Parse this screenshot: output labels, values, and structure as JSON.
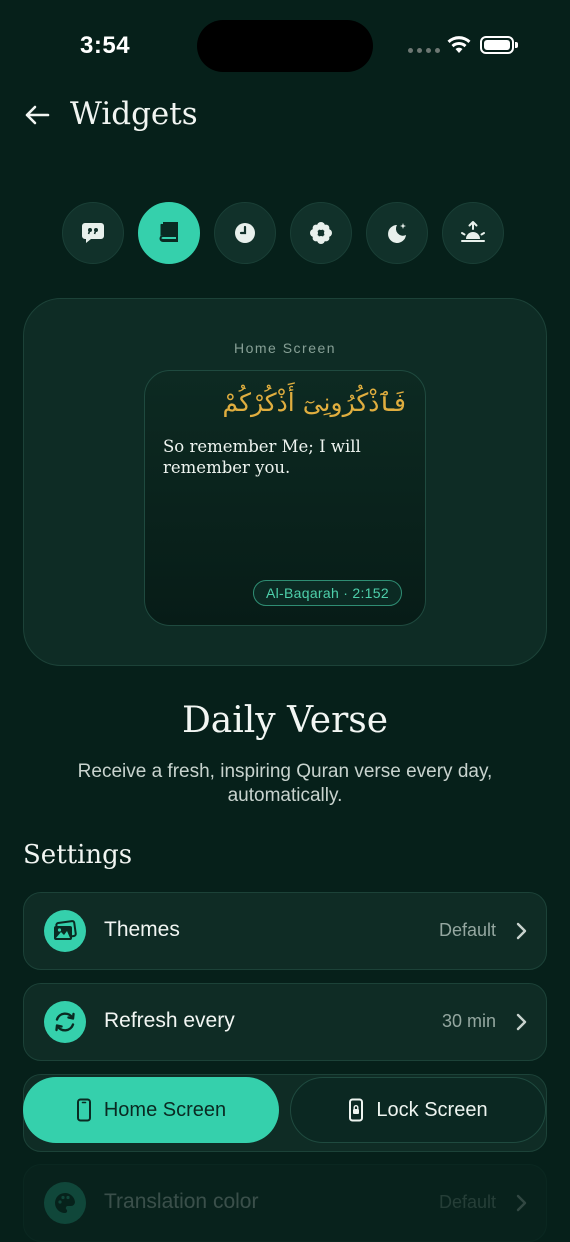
{
  "status_bar": {
    "time": "3:54"
  },
  "header": {
    "title": "Widgets"
  },
  "widget_types": [
    {
      "name": "quote",
      "icon": "quote-bubble-icon",
      "active": false
    },
    {
      "name": "quran",
      "icon": "book-icon",
      "active": true
    },
    {
      "name": "prayer-time",
      "icon": "clock-icon",
      "active": false
    },
    {
      "name": "tasbih",
      "icon": "flower-icon",
      "active": false
    },
    {
      "name": "night",
      "icon": "moon-star-icon",
      "active": false
    },
    {
      "name": "sunrise",
      "icon": "sunrise-icon",
      "active": false
    }
  ],
  "preview": {
    "label": "Home Screen",
    "arabic": "فَٱذْكُرُونِىٓ أَذْكُرْكُمْ",
    "translation": "So remember Me; I will remember you.",
    "reference": "Al-Baqarah · 2:152"
  },
  "widget_info": {
    "title": "Daily Verse",
    "description": "Receive a fresh, inspiring Quran verse every day, automatically."
  },
  "settings": {
    "title": "Settings",
    "rows": [
      {
        "label": "Themes",
        "value": "Default",
        "icon": "gallery-icon"
      },
      {
        "label": "Refresh every",
        "value": "30 min",
        "icon": "refresh-icon"
      },
      {
        "label": "Translation color",
        "value": "Default",
        "icon": "palette-icon"
      }
    ]
  },
  "placement_toggle": {
    "home_label": "Home Screen",
    "lock_label": "Lock Screen",
    "selected": "Home Screen"
  },
  "colors": {
    "background": "#06201a",
    "accent": "#35d0ac",
    "arabic_text": "#e0ae3f"
  }
}
